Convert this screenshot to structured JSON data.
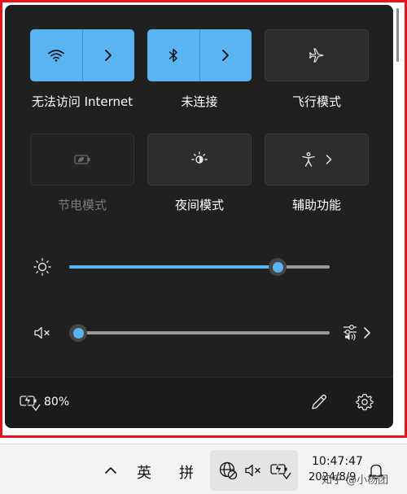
{
  "quick_settings": {
    "tiles": [
      {
        "id": "wifi",
        "label": "无法访问 Internet",
        "icon": "wifi-icon",
        "state": "on"
      },
      {
        "id": "bluetooth",
        "label": "未连接",
        "icon": "bluetooth-icon",
        "state": "on"
      },
      {
        "id": "airplane",
        "label": "飞行模式",
        "icon": "airplane-icon",
        "state": "off"
      },
      {
        "id": "battery_saver",
        "label": "节电模式",
        "icon": "battery-saver-icon",
        "state": "disabled"
      },
      {
        "id": "night_light",
        "label": "夜间模式",
        "icon": "night-light-icon",
        "state": "off"
      },
      {
        "id": "accessibility",
        "label": "辅助功能",
        "icon": "accessibility-icon",
        "state": "off"
      }
    ],
    "brightness": {
      "icon": "brightness-icon",
      "level": 0.8
    },
    "volume": {
      "icon": "volume-muted-icon",
      "level": 0.0,
      "output_icon": "audio-output-settings-icon"
    },
    "footer": {
      "battery_icon": "battery-charging-icon",
      "battery_percent": "80%",
      "edit_icon": "pencil-icon",
      "settings_icon": "gear-icon"
    }
  },
  "taskbar": {
    "overflow_icon": "chevron-up-icon",
    "ime_language": "英",
    "ime_mode": "拼",
    "tray_icons": [
      "network-no-internet-icon",
      "volume-muted-icon",
      "battery-charging-icon"
    ],
    "time": "10:47:47",
    "date": "2024/8/9",
    "watermark": "知乎 @小杨团",
    "notification_icon": "bell-icon"
  },
  "colors": {
    "accent": "#5ab4f2",
    "panel_bg": "#202020",
    "frame": "#e8141b"
  }
}
